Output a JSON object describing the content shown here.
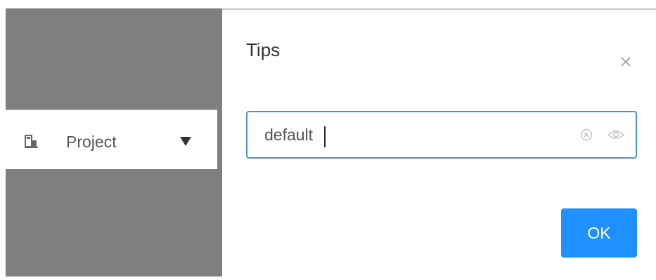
{
  "background": {
    "overlay_color": "#7f7f7f"
  },
  "sidebar": {
    "project_item": {
      "label": "Project",
      "icon": "project-icon",
      "caret_icon": "caret-down-icon"
    }
  },
  "dialog": {
    "title": "Tips",
    "close_icon": "close-icon",
    "input": {
      "value": "default",
      "focused": true,
      "border_color": "#4a90e2",
      "clear_icon": "clear-circle-icon",
      "visibility_icon": "eye-icon"
    },
    "ok_button": {
      "label": "OK",
      "color": "#1e90ff"
    }
  }
}
